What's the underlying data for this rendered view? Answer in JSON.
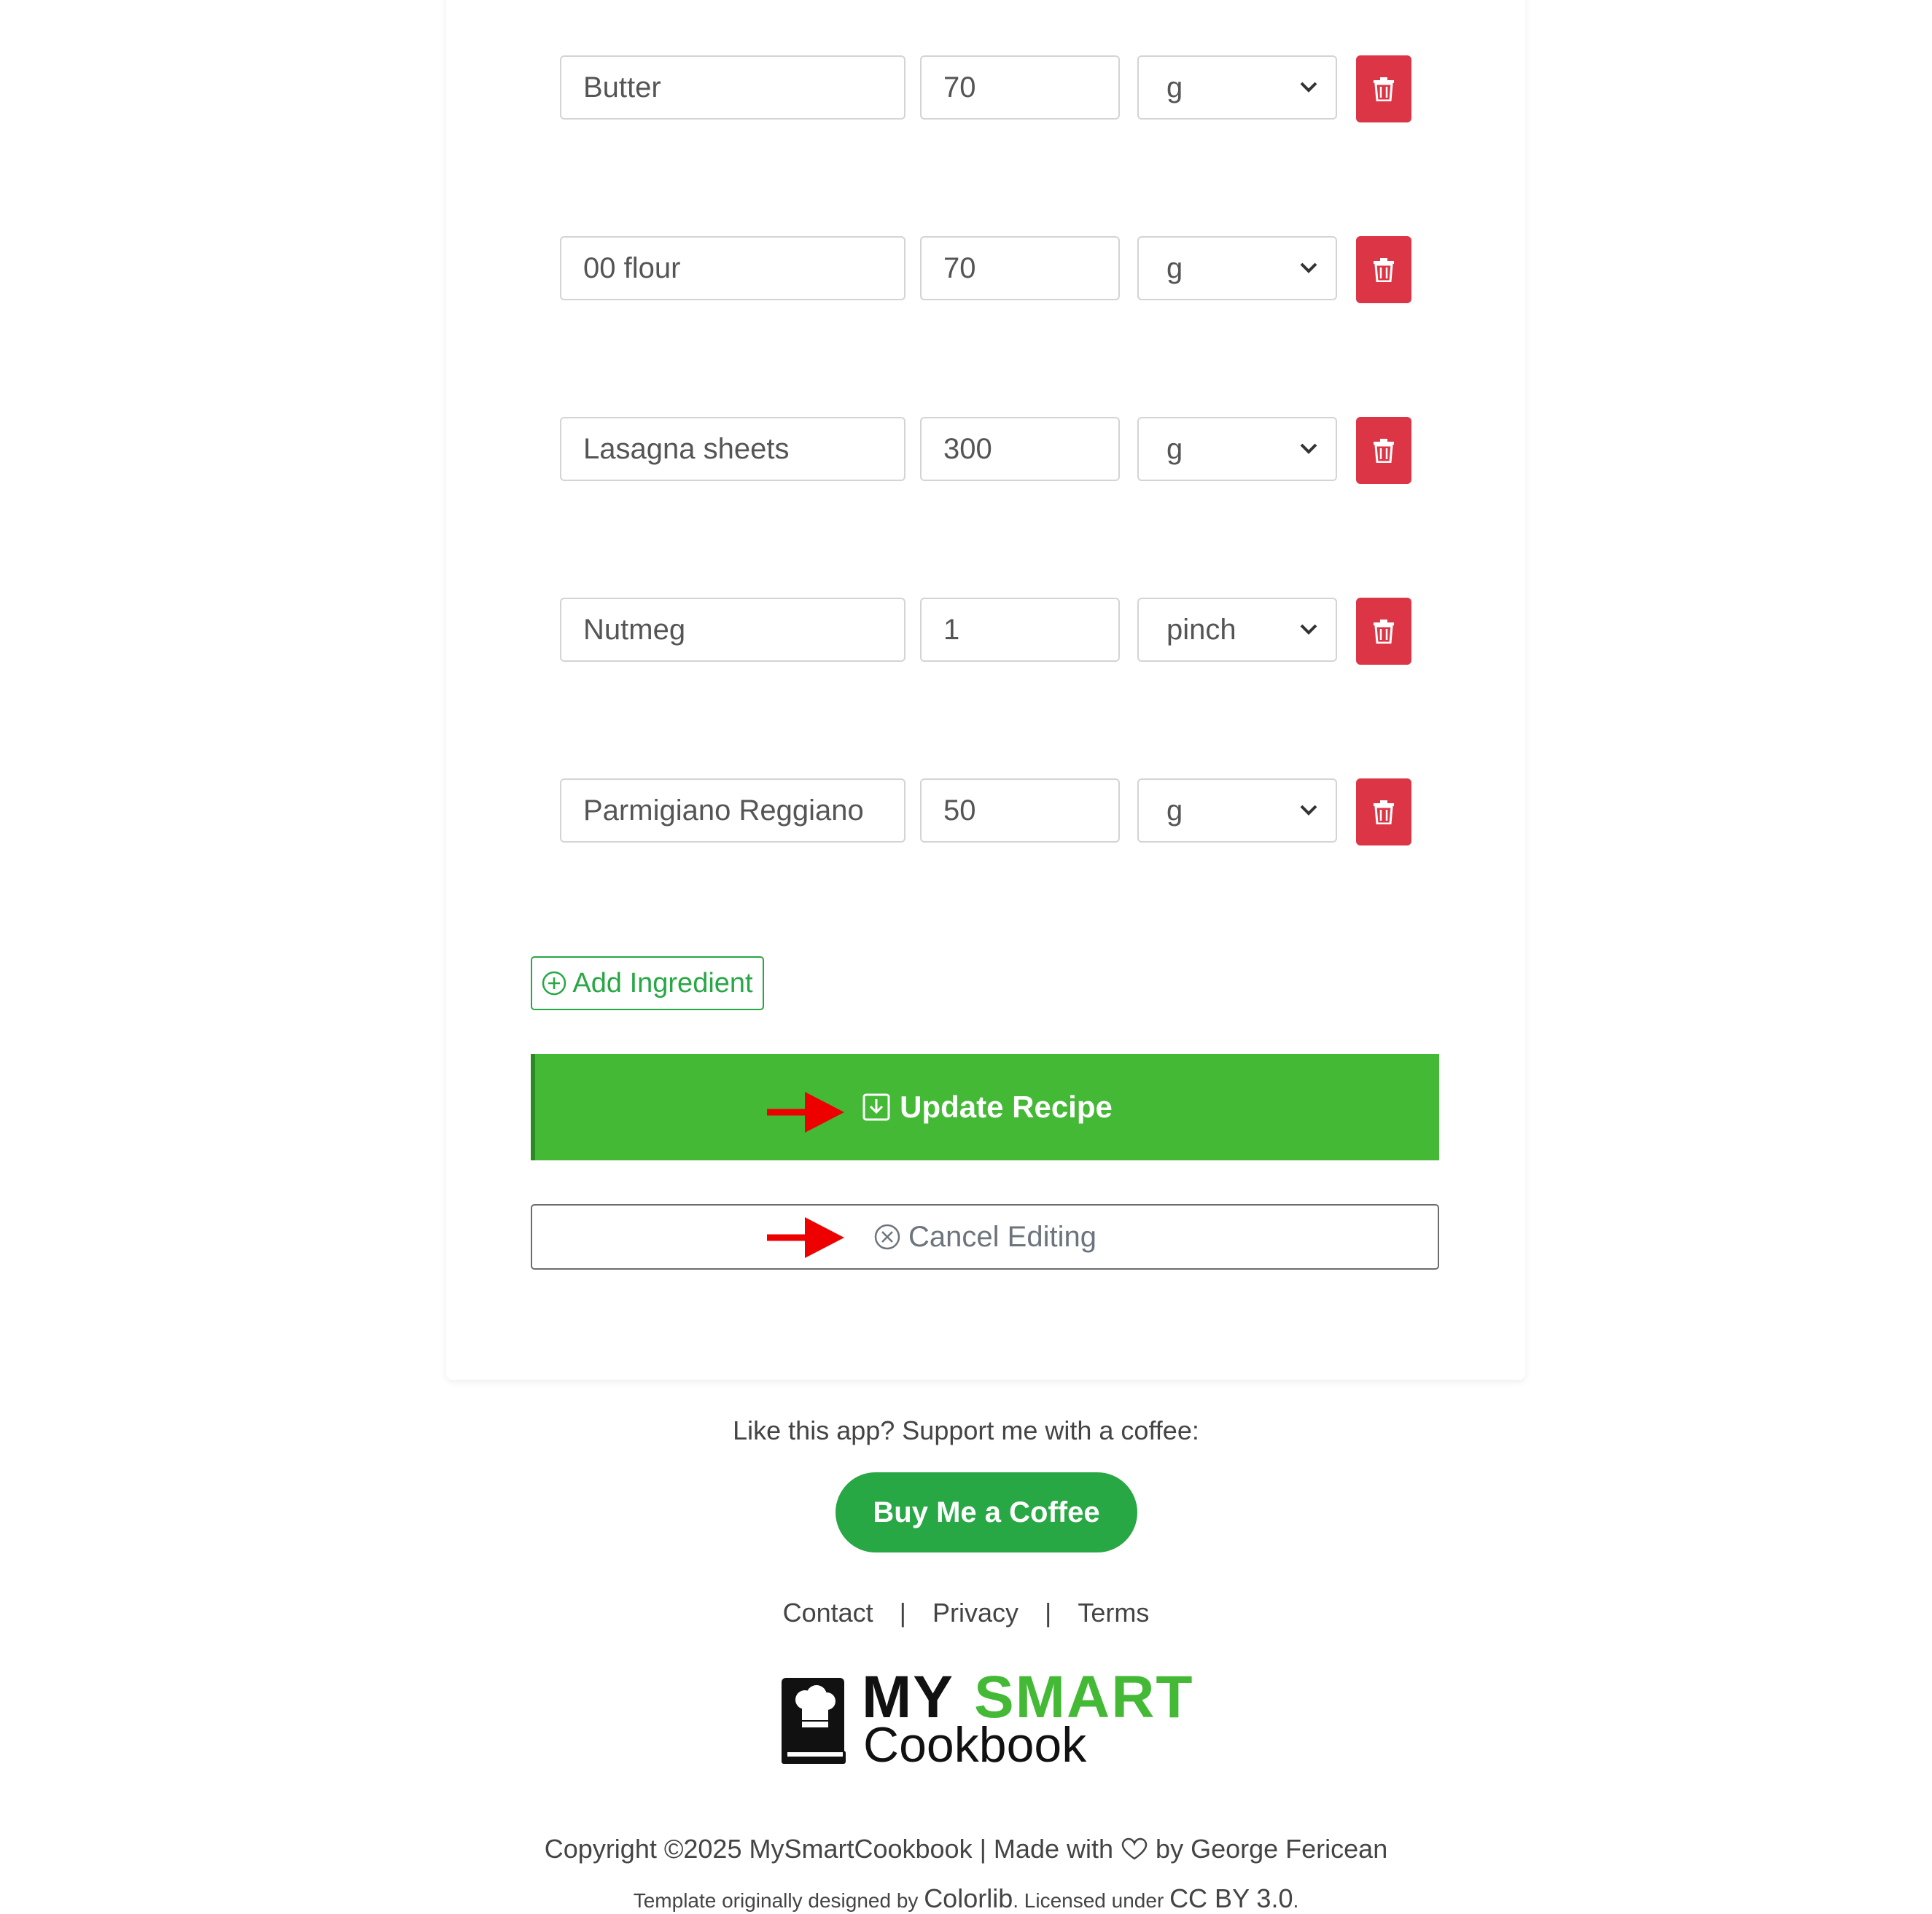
{
  "ingredients": [
    {
      "name": "Butter",
      "quantity": "70",
      "unit": "g"
    },
    {
      "name": "00 flour",
      "quantity": "70",
      "unit": "g"
    },
    {
      "name": "Lasagna sheets",
      "quantity": "300",
      "unit": "g"
    },
    {
      "name": "Nutmeg",
      "quantity": "1",
      "unit": "pinch"
    },
    {
      "name": "Parmigiano Reggiano",
      "quantity": "50",
      "unit": "g"
    }
  ],
  "icons": {
    "delete": "trash-icon",
    "add": "plus-circle-icon",
    "update": "save-download-icon",
    "cancel": "x-circle-icon",
    "unit_dropdown": "chevron-down-icon",
    "pointer": "red-arrow-icon",
    "heart": "heart-icon",
    "logo": "chef-hat-book-icon"
  },
  "actions": {
    "add_label": "Add Ingredient",
    "update_label": "Update Recipe",
    "cancel_label": "Cancel Editing"
  },
  "footer": {
    "support_text": "Like this app? Support me with a coffee:",
    "coffee_label": "Buy Me a Coffee",
    "links": [
      "Contact",
      "Privacy",
      "Terms"
    ],
    "separator": "|",
    "logo": {
      "word1": "MY",
      "word2": "SMART",
      "word3": "Cookbook"
    },
    "copyright_before": "Copyright ©2025 MySmartCookbook | Made with",
    "copyright_after": "by George Fericean",
    "credit_prefix": "Template originally designed by",
    "credit_brand": "Colorlib",
    "credit_middle": ". Licensed under",
    "credit_license": "CC BY 3.0",
    "credit_suffix": "."
  },
  "colors": {
    "primary_green": "#43b935",
    "success_green": "#28a745",
    "danger_red": "#dc3545",
    "annotation_arrow": "#ee0000"
  }
}
